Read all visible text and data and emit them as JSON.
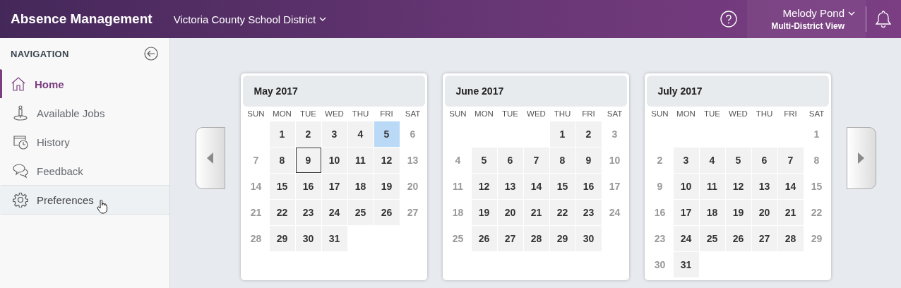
{
  "app": {
    "title": "Absence Management",
    "district": "Victoria County School District",
    "user_name": "Melody Pond",
    "view": "Multi-District View"
  },
  "sidebar": {
    "heading": "NAVIGATION",
    "items": [
      {
        "label": "Home",
        "kind": "home",
        "selected": true,
        "hovered": false
      },
      {
        "label": "Available Jobs",
        "kind": "jobs",
        "selected": false,
        "hovered": false
      },
      {
        "label": "History",
        "kind": "history",
        "selected": false,
        "hovered": false
      },
      {
        "label": "Feedback",
        "kind": "feedback",
        "selected": false,
        "hovered": false
      },
      {
        "label": "Preferences",
        "kind": "preferences",
        "selected": false,
        "hovered": true
      }
    ]
  },
  "calendars": [
    {
      "title": "May 2017",
      "weekdays": [
        "SUN",
        "MON",
        "TUE",
        "WED",
        "THU",
        "FRI",
        "SAT"
      ],
      "weeks": [
        [
          {
            "kind": "blank"
          },
          {
            "day": "1",
            "kind": "weekday",
            "selected": false,
            "outlined": false
          },
          {
            "day": "2",
            "kind": "weekday",
            "selected": false,
            "outlined": false
          },
          {
            "day": "3",
            "kind": "weekday",
            "selected": false,
            "outlined": false
          },
          {
            "day": "4",
            "kind": "weekday",
            "selected": false,
            "outlined": false
          },
          {
            "day": "5",
            "kind": "weekday",
            "selected": true,
            "outlined": false
          },
          {
            "day": "6",
            "kind": "weekend",
            "selected": false,
            "outlined": false
          }
        ],
        [
          {
            "day": "7",
            "kind": "weekend",
            "selected": false,
            "outlined": false
          },
          {
            "day": "8",
            "kind": "weekday",
            "selected": false,
            "outlined": false
          },
          {
            "day": "9",
            "kind": "weekday",
            "selected": false,
            "outlined": true
          },
          {
            "day": "10",
            "kind": "weekday",
            "selected": false,
            "outlined": false
          },
          {
            "day": "11",
            "kind": "weekday",
            "selected": false,
            "outlined": false
          },
          {
            "day": "12",
            "kind": "weekday",
            "selected": false,
            "outlined": false
          },
          {
            "day": "13",
            "kind": "weekend",
            "selected": false,
            "outlined": false
          }
        ],
        [
          {
            "day": "14",
            "kind": "weekend",
            "selected": false,
            "outlined": false
          },
          {
            "day": "15",
            "kind": "weekday",
            "selected": false,
            "outlined": false
          },
          {
            "day": "16",
            "kind": "weekday",
            "selected": false,
            "outlined": false
          },
          {
            "day": "17",
            "kind": "weekday",
            "selected": false,
            "outlined": false
          },
          {
            "day": "18",
            "kind": "weekday",
            "selected": false,
            "outlined": false
          },
          {
            "day": "19",
            "kind": "weekday",
            "selected": false,
            "outlined": false
          },
          {
            "day": "20",
            "kind": "weekend",
            "selected": false,
            "outlined": false
          }
        ],
        [
          {
            "day": "21",
            "kind": "weekend",
            "selected": false,
            "outlined": false
          },
          {
            "day": "22",
            "kind": "weekday",
            "selected": false,
            "outlined": false
          },
          {
            "day": "23",
            "kind": "weekday",
            "selected": false,
            "outlined": false
          },
          {
            "day": "24",
            "kind": "weekday",
            "selected": false,
            "outlined": false
          },
          {
            "day": "25",
            "kind": "weekday",
            "selected": false,
            "outlined": false
          },
          {
            "day": "26",
            "kind": "weekday",
            "selected": false,
            "outlined": false
          },
          {
            "day": "27",
            "kind": "weekend",
            "selected": false,
            "outlined": false
          }
        ],
        [
          {
            "day": "28",
            "kind": "weekend",
            "selected": false,
            "outlined": false
          },
          {
            "day": "29",
            "kind": "weekday",
            "selected": false,
            "outlined": false
          },
          {
            "day": "30",
            "kind": "weekday",
            "selected": false,
            "outlined": false
          },
          {
            "day": "31",
            "kind": "weekday",
            "selected": false,
            "outlined": false
          },
          {
            "kind": "blank"
          },
          {
            "kind": "blank"
          },
          {
            "kind": "blank"
          }
        ]
      ]
    },
    {
      "title": "June 2017",
      "weekdays": [
        "SUN",
        "MON",
        "TUE",
        "WED",
        "THU",
        "FRI",
        "SAT"
      ],
      "weeks": [
        [
          {
            "kind": "blank"
          },
          {
            "kind": "blank"
          },
          {
            "kind": "blank"
          },
          {
            "kind": "blank"
          },
          {
            "day": "1",
            "kind": "weekday",
            "selected": false,
            "outlined": false
          },
          {
            "day": "2",
            "kind": "weekday",
            "selected": false,
            "outlined": false
          },
          {
            "day": "3",
            "kind": "weekend",
            "selected": false,
            "outlined": false
          }
        ],
        [
          {
            "day": "4",
            "kind": "weekend",
            "selected": false,
            "outlined": false
          },
          {
            "day": "5",
            "kind": "weekday",
            "selected": false,
            "outlined": false
          },
          {
            "day": "6",
            "kind": "weekday",
            "selected": false,
            "outlined": false
          },
          {
            "day": "7",
            "kind": "weekday",
            "selected": false,
            "outlined": false
          },
          {
            "day": "8",
            "kind": "weekday",
            "selected": false,
            "outlined": false
          },
          {
            "day": "9",
            "kind": "weekday",
            "selected": false,
            "outlined": false
          },
          {
            "day": "10",
            "kind": "weekend",
            "selected": false,
            "outlined": false
          }
        ],
        [
          {
            "day": "11",
            "kind": "weekend",
            "selected": false,
            "outlined": false
          },
          {
            "day": "12",
            "kind": "weekday",
            "selected": false,
            "outlined": false
          },
          {
            "day": "13",
            "kind": "weekday",
            "selected": false,
            "outlined": false
          },
          {
            "day": "14",
            "kind": "weekday",
            "selected": false,
            "outlined": false
          },
          {
            "day": "15",
            "kind": "weekday",
            "selected": false,
            "outlined": false
          },
          {
            "day": "16",
            "kind": "weekday",
            "selected": false,
            "outlined": false
          },
          {
            "day": "17",
            "kind": "weekend",
            "selected": false,
            "outlined": false
          }
        ],
        [
          {
            "day": "18",
            "kind": "weekend",
            "selected": false,
            "outlined": false
          },
          {
            "day": "19",
            "kind": "weekday",
            "selected": false,
            "outlined": false
          },
          {
            "day": "20",
            "kind": "weekday",
            "selected": false,
            "outlined": false
          },
          {
            "day": "21",
            "kind": "weekday",
            "selected": false,
            "outlined": false
          },
          {
            "day": "22",
            "kind": "weekday",
            "selected": false,
            "outlined": false
          },
          {
            "day": "23",
            "kind": "weekday",
            "selected": false,
            "outlined": false
          },
          {
            "day": "24",
            "kind": "weekend",
            "selected": false,
            "outlined": false
          }
        ],
        [
          {
            "day": "25",
            "kind": "weekend",
            "selected": false,
            "outlined": false
          },
          {
            "day": "26",
            "kind": "weekday",
            "selected": false,
            "outlined": false
          },
          {
            "day": "27",
            "kind": "weekday",
            "selected": false,
            "outlined": false
          },
          {
            "day": "28",
            "kind": "weekday",
            "selected": false,
            "outlined": false
          },
          {
            "day": "29",
            "kind": "weekday",
            "selected": false,
            "outlined": false
          },
          {
            "day": "30",
            "kind": "weekday",
            "selected": false,
            "outlined": false
          },
          {
            "kind": "blank"
          }
        ]
      ]
    },
    {
      "title": "July 2017",
      "weekdays": [
        "SUN",
        "MON",
        "TUE",
        "WED",
        "THU",
        "FRI",
        "SAT"
      ],
      "weeks": [
        [
          {
            "kind": "blank"
          },
          {
            "kind": "blank"
          },
          {
            "kind": "blank"
          },
          {
            "kind": "blank"
          },
          {
            "kind": "blank"
          },
          {
            "kind": "blank"
          },
          {
            "day": "1",
            "kind": "weekend",
            "selected": false,
            "outlined": false
          }
        ],
        [
          {
            "day": "2",
            "kind": "weekend",
            "selected": false,
            "outlined": false
          },
          {
            "day": "3",
            "kind": "weekday",
            "selected": false,
            "outlined": false
          },
          {
            "day": "4",
            "kind": "weekday",
            "selected": false,
            "outlined": false
          },
          {
            "day": "5",
            "kind": "weekday",
            "selected": false,
            "outlined": false
          },
          {
            "day": "6",
            "kind": "weekday",
            "selected": false,
            "outlined": false
          },
          {
            "day": "7",
            "kind": "weekday",
            "selected": false,
            "outlined": false
          },
          {
            "day": "8",
            "kind": "weekend",
            "selected": false,
            "outlined": false
          }
        ],
        [
          {
            "day": "9",
            "kind": "weekend",
            "selected": false,
            "outlined": false
          },
          {
            "day": "10",
            "kind": "weekday",
            "selected": false,
            "outlined": false
          },
          {
            "day": "11",
            "kind": "weekday",
            "selected": false,
            "outlined": false
          },
          {
            "day": "12",
            "kind": "weekday",
            "selected": false,
            "outlined": false
          },
          {
            "day": "13",
            "kind": "weekday",
            "selected": false,
            "outlined": false
          },
          {
            "day": "14",
            "kind": "weekday",
            "selected": false,
            "outlined": false
          },
          {
            "day": "15",
            "kind": "weekend",
            "selected": false,
            "outlined": false
          }
        ],
        [
          {
            "day": "16",
            "kind": "weekend",
            "selected": false,
            "outlined": false
          },
          {
            "day": "17",
            "kind": "weekday",
            "selected": false,
            "outlined": false
          },
          {
            "day": "18",
            "kind": "weekday",
            "selected": false,
            "outlined": false
          },
          {
            "day": "19",
            "kind": "weekday",
            "selected": false,
            "outlined": false
          },
          {
            "day": "20",
            "kind": "weekday",
            "selected": false,
            "outlined": false
          },
          {
            "day": "21",
            "kind": "weekday",
            "selected": false,
            "outlined": false
          },
          {
            "day": "22",
            "kind": "weekend",
            "selected": false,
            "outlined": false
          }
        ],
        [
          {
            "day": "23",
            "kind": "weekend",
            "selected": false,
            "outlined": false
          },
          {
            "day": "24",
            "kind": "weekday",
            "selected": false,
            "outlined": false
          },
          {
            "day": "25",
            "kind": "weekday",
            "selected": false,
            "outlined": false
          },
          {
            "day": "26",
            "kind": "weekday",
            "selected": false,
            "outlined": false
          },
          {
            "day": "27",
            "kind": "weekday",
            "selected": false,
            "outlined": false
          },
          {
            "day": "28",
            "kind": "weekday",
            "selected": false,
            "outlined": false
          },
          {
            "day": "29",
            "kind": "weekend",
            "selected": false,
            "outlined": false
          }
        ],
        [
          {
            "day": "30",
            "kind": "weekend",
            "selected": false,
            "outlined": false
          },
          {
            "day": "31",
            "kind": "weekday",
            "selected": false,
            "outlined": false
          },
          {
            "kind": "blank"
          },
          {
            "kind": "blank"
          },
          {
            "kind": "blank"
          },
          {
            "kind": "blank"
          },
          {
            "kind": "blank"
          }
        ]
      ]
    }
  ]
}
